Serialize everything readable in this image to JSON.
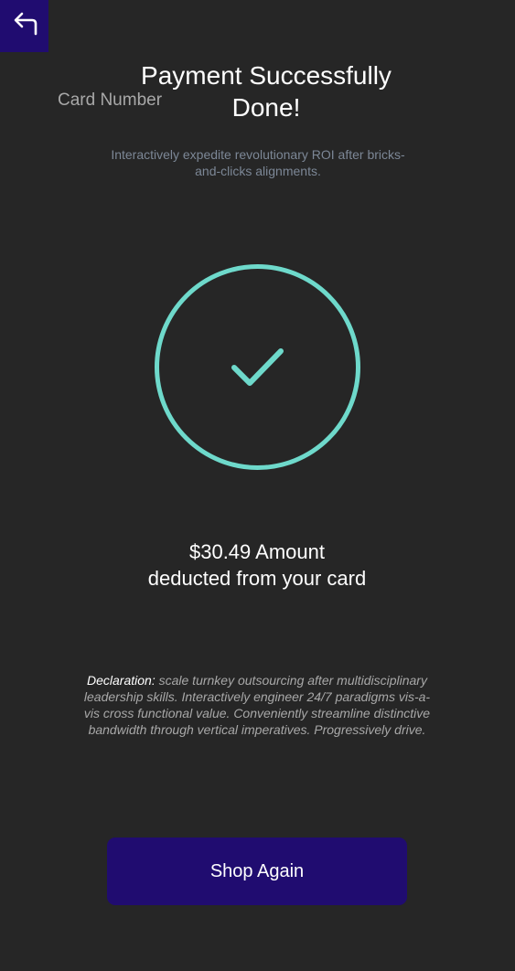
{
  "header": {
    "back_icon": "back-arrow-icon",
    "card_label": "Card Number",
    "title": "Payment Successfully Done!",
    "subtitle": "Interactively expedite revolutionary ROI after bricks-and-clicks alignments."
  },
  "status": {
    "icon": "check-circle-icon",
    "accent_color": "#6ed9cb"
  },
  "amount": {
    "line1": "$30.49 Amount",
    "line2": "deducted from your card"
  },
  "declaration": {
    "label": "Declaration:",
    "text": "scale turnkey outsourcing after multidisciplinary leadership skills. Interactively engineer 24/7 paradigms vis-a-vis cross functional value. Conveniently streamline distinctive bandwidth through vertical imperatives. Progressively drive."
  },
  "actions": {
    "shop_again_label": "Shop Again",
    "button_color": "#200c70"
  }
}
